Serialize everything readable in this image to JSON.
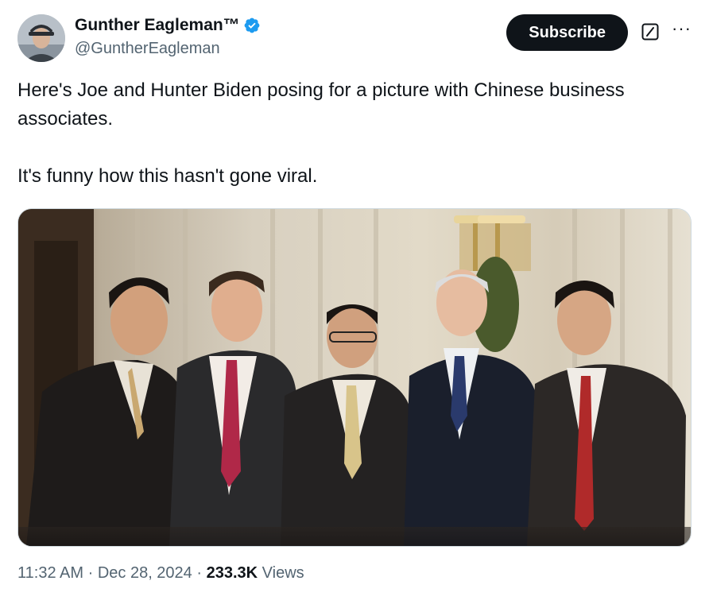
{
  "author": {
    "display_name": "Gunther Eagleman™",
    "handle": "@GuntherEagleman",
    "verified": true,
    "avatar_icon": "profile-photo-avatar"
  },
  "actions": {
    "subscribe_label": "Subscribe",
    "grok_icon": "grok-icon",
    "more_icon": "more-options-icon",
    "more_glyph": "···"
  },
  "tweet": {
    "paragraph_1": "Here's Joe and Hunter Biden posing for a picture with Chinese business associates.",
    "paragraph_2": "It's funny how this hasn't gone viral."
  },
  "media": {
    "alt": "Photo of five men in suits posing together in a hotel room"
  },
  "meta": {
    "time": "11:32 AM",
    "separator": "·",
    "date": "Dec 28, 2024",
    "views_count": "233.3K",
    "views_label": "Views"
  },
  "colors": {
    "verified_blue": "#1d9bf0",
    "secondary_text": "#536471",
    "button_black": "#0f1419"
  }
}
